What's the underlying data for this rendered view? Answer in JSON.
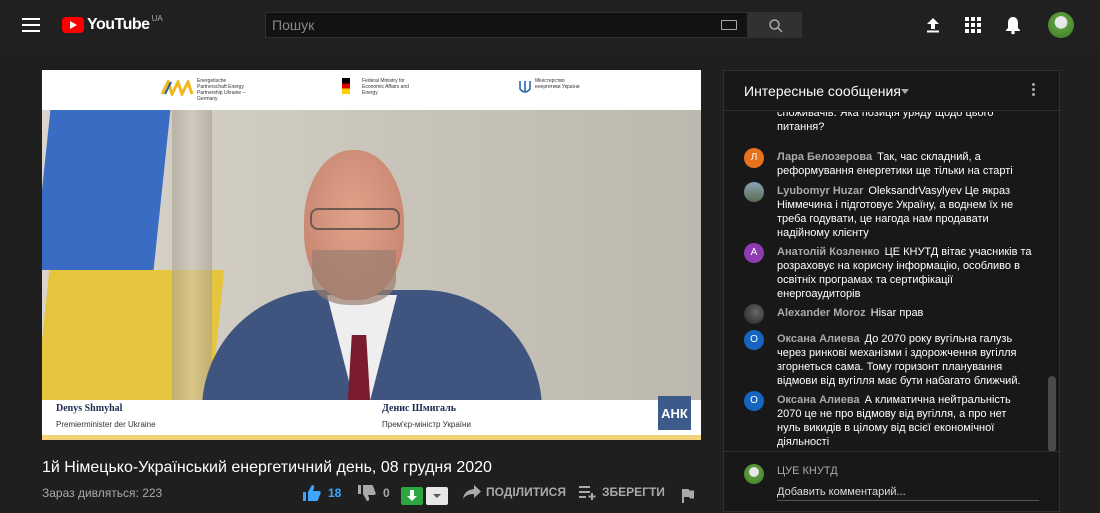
{
  "header": {
    "logo_text": "YouTube",
    "logo_country": "UA",
    "search_placeholder": "Пошук"
  },
  "player": {
    "banner": {
      "partner1": "Energetische Partnerschaft Energy Partnership Ukraine – Germany",
      "partner2": "Federal Ministry for Economic Affairs and Energy",
      "partner3": "Міністерство енергетики України"
    },
    "lower_third": {
      "name_left": "Denys Shmyhal",
      "role_left": "Premierminister der Ukraine",
      "name_right": "Денис Шмигаль",
      "role_right": "Прем'єр-міністр України"
    },
    "channel_badge": "АНК"
  },
  "video": {
    "title": "1й Німецько-Український енергетичний день, 08 грудня 2020",
    "views": "Зараз дивляться: 223",
    "likes": "18",
    "dislikes": "0",
    "share_label": "ПОДІЛИТИСЯ",
    "save_label": "ЗБЕРЕГТИ"
  },
  "chat": {
    "title": "Интересные сообщения",
    "messages": [
      {
        "author": "",
        "text": "споживачів. Яка позиція уряду щодо цього питання?",
        "avatar_letter": "",
        "avatar_color": ""
      },
      {
        "author": "Лара Белозерова",
        "text": "Так, час складний, а реформування енергетики ще тільки на старті",
        "avatar_letter": "Л",
        "avatar_color": "#e8721c"
      },
      {
        "author": "Lyubomyr Huzar",
        "text": "OleksandrVasylyev Це якраз Німмечина і підготовує Україну, а воднем їх не треба годувати, це нагода нам продавати надійному клієнту",
        "avatar_letter": "",
        "avatar_color": "#7a8a9a"
      },
      {
        "author": "Анатолій Козленко",
        "text": "ЦЕ КНУТД вітає учасників та розраховує на корисну інформацію, особливо в освітніх програмах та сертифікації енергоаудиторів",
        "avatar_letter": "А",
        "avatar_color": "#8e3ab0"
      },
      {
        "author": "Alexander Moroz",
        "text": "Hisar прав",
        "avatar_letter": "",
        "avatar_color": "#3a3a3a"
      },
      {
        "author": "Оксана Алиева",
        "text": "До 2070 року вугільна галузь через ринкові механізми і здорожчення вугілля згорнеться сама. Тому горизонт планування відмови від вугілля має бути набагато ближчий.",
        "avatar_letter": "О",
        "avatar_color": "#1565c0"
      },
      {
        "author": "Оксана Алиева",
        "text": "А климатична нейтральність 2070 це не про відмову від вугілля, а про нет нуль викидів в цілому від всієї економічної діяльності",
        "avatar_letter": "О",
        "avatar_color": "#1565c0"
      }
    ],
    "me_name": "ЦУЕ КНУТД",
    "comment_placeholder": "Добавить комментарий..."
  },
  "colors": {
    "accent": "#3ea6ff",
    "brand": "#ff0000",
    "download": "#2ba640"
  }
}
